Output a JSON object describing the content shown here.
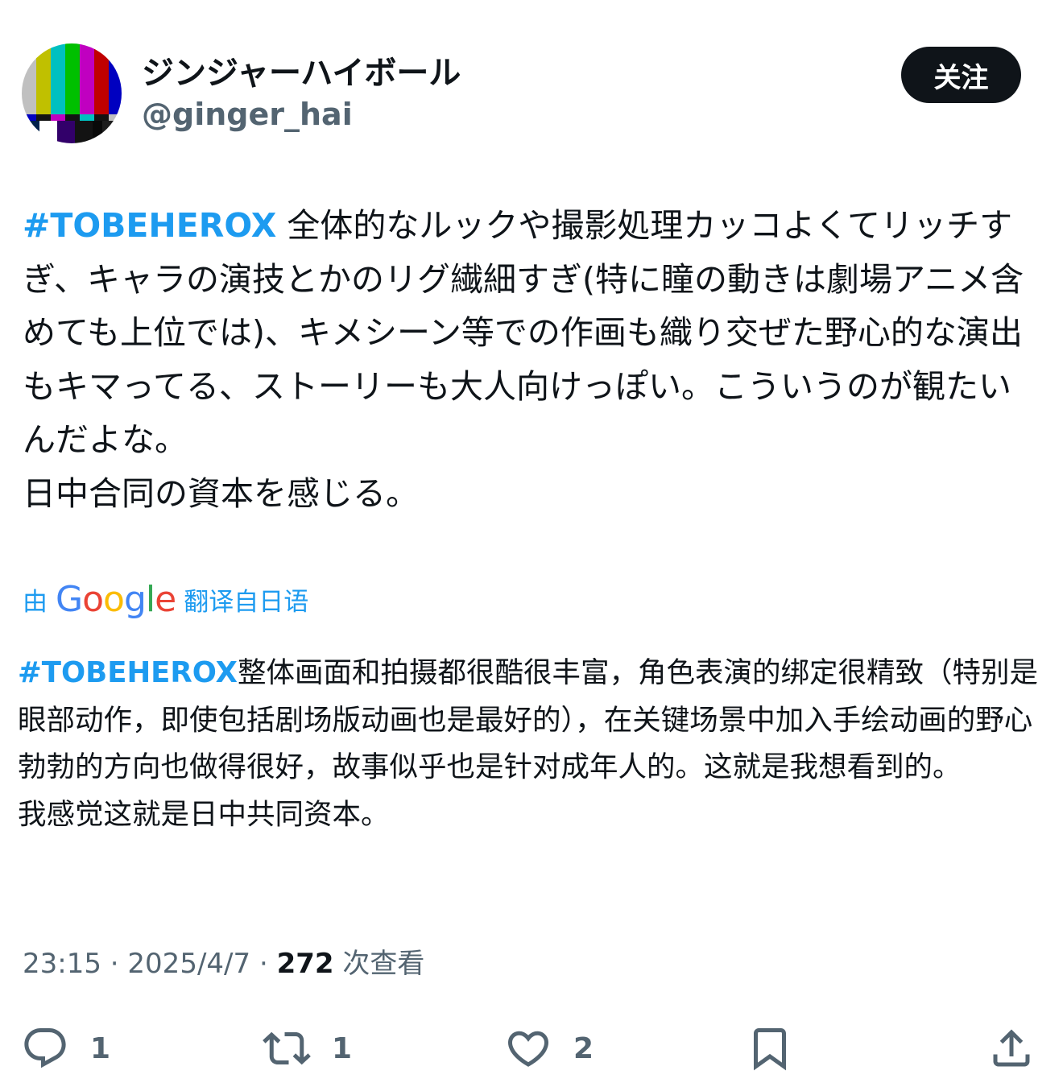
{
  "author": {
    "display_name": "ジンジャーハイボール",
    "handle": "@ginger_hai"
  },
  "follow_button": {
    "label": "关注"
  },
  "tweet": {
    "hashtag": "#TOBEHEROX",
    "body_line1": " 全体的なルックや撮影処理カッコよくてリッチすぎ、キャラの演技とかのリグ繊細すぎ(特に瞳の動きは劇場アニメ含めても上位では)、キメシーン等での作画も織り交ぜた野心的な演出もキマってる、ストーリーも大人向けっぽい。こういうのが観たいんだよな。",
    "body_line2": "日中合同の資本を感じる。"
  },
  "translation": {
    "prefix": "由",
    "provider": "Google",
    "suffix": "翻译自日语",
    "hashtag": "#TOBEHEROX",
    "body_line1": "整体画面和拍摄都很酷很丰富，角色表演的绑定很精致（特别是眼部动作，即使包括剧场版动画也是最好的），在关键场景中加入手绘动画的野心勃勃的方向也做得很好，故事似乎也是针对成年人的。这就是我想看到的。",
    "body_line2": "我感觉这就是日中共同资本。"
  },
  "meta": {
    "time": "23:15",
    "date": "2025/4/7",
    "separator": "·",
    "views_count": "272",
    "views_label": "次查看"
  },
  "actions": {
    "reply": {
      "icon": "reply-icon",
      "count": "1"
    },
    "retweet": {
      "icon": "retweet-icon",
      "count": "1"
    },
    "like": {
      "icon": "heart-icon",
      "count": "2"
    },
    "bookmark": {
      "icon": "bookmark-icon"
    },
    "share": {
      "icon": "share-icon"
    }
  },
  "colors": {
    "accent": "#1d9bf0",
    "text": "#0f1419",
    "secondary": "#536471",
    "google_blue": "#4285F4",
    "google_red": "#EA4335",
    "google_yellow": "#FBBC05",
    "google_green": "#34A853"
  }
}
